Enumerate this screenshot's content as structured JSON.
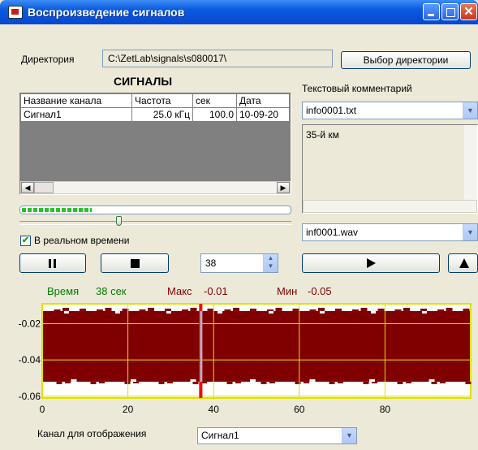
{
  "window": {
    "title": "Воспроизведение сигналов"
  },
  "directory": {
    "label": "Директория",
    "path": "C:\\ZetLab\\signals\\s080017\\",
    "button": "Выбор директории"
  },
  "signals": {
    "header": "СИГНАЛЫ",
    "columns": [
      "Название канала",
      "Частота",
      "сек",
      "Дата"
    ],
    "rows": [
      {
        "name": "Сигнал1",
        "freq": "25.0 кГц",
        "sec": "100.0",
        "date": "10-09-20"
      }
    ]
  },
  "realtime": {
    "label": "В реальном времени",
    "checked": true
  },
  "playback": {
    "position": "38",
    "progress": 0.26
  },
  "comment": {
    "label": "Текстовый комментарий",
    "file": "info0001.txt",
    "text": "35-й км",
    "wav": "inf0001.wav"
  },
  "stats": {
    "time_label": "Время",
    "time_value": "38 сек",
    "max_label": "Макс",
    "max_value": "-0.01",
    "min_label": "Мин",
    "min_value": "-0.05"
  },
  "channel": {
    "label": "Канал для отображения",
    "value": "Сигнал1"
  },
  "colors": {
    "accent": "#0a5ae0",
    "signal": "#800000",
    "grid": "#e0e000",
    "cursor": "#ff0000",
    "stat_green": "#008000",
    "stat_red": "#800000"
  },
  "chart_data": {
    "type": "area",
    "x_ticks": [
      0,
      20,
      40,
      60,
      80
    ],
    "y_ticks": [
      -0.02,
      -0.04,
      -0.06
    ],
    "xlim": [
      0,
      100
    ],
    "ylim": [
      -0.061,
      -0.009
    ],
    "cursor_x": 37,
    "band": {
      "upper": -0.013,
      "lower": -0.052
    }
  }
}
